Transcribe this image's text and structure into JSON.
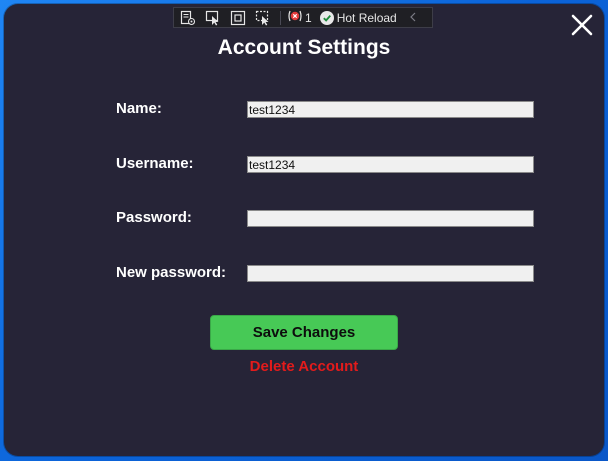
{
  "toolbar": {
    "error_count": "1",
    "hot_reload_label": "Hot Reload"
  },
  "dialog": {
    "title": "Account Settings",
    "close_glyph": "X"
  },
  "form": {
    "fields": [
      {
        "label": "Name:",
        "value": "test1234"
      },
      {
        "label": "Username:",
        "value": "test1234"
      },
      {
        "label": "Password:",
        "value": ""
      },
      {
        "label": "New password:",
        "value": ""
      }
    ]
  },
  "actions": {
    "save_label": "Save Changes",
    "delete_label": "Delete Account"
  },
  "colors": {
    "background": "#262437",
    "save_button": "#47c956",
    "delete_text": "#e31b1b",
    "desktop": "#0f6fe0"
  }
}
